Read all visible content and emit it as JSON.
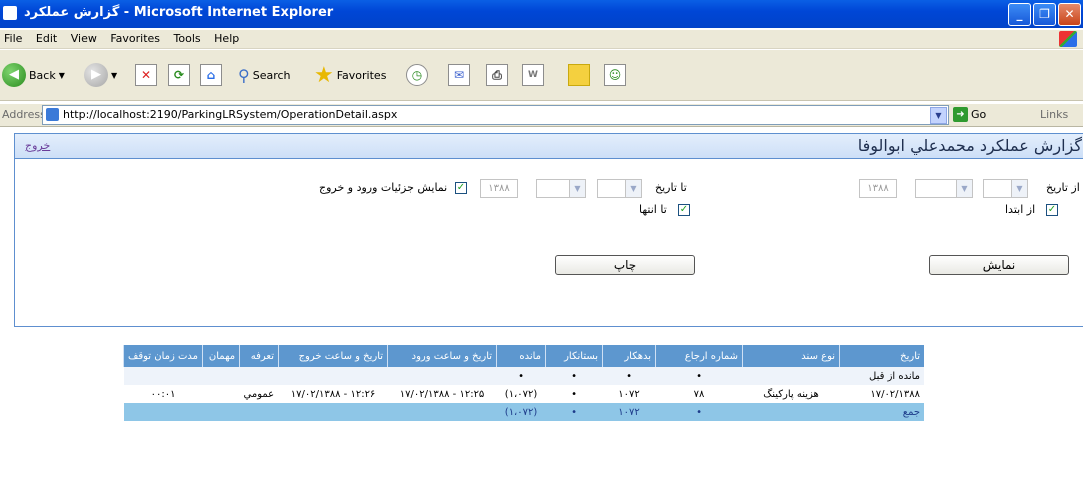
{
  "window": {
    "title": "گزارش عملكرد - Microsoft Internet Explorer"
  },
  "menu": [
    "File",
    "Edit",
    "View",
    "Favorites",
    "Tools",
    "Help"
  ],
  "toolbar": {
    "back_label": "Back",
    "search_label": "Search",
    "favorites_label": "Favorites"
  },
  "address": {
    "label": "Address",
    "url": "http://localhost:2190/ParkingLRSystem/OperationDetail.aspx",
    "go_label": "Go",
    "links_label": "Links"
  },
  "page": {
    "title": "گزارش عملكرد محمدعلي ابوالوفا",
    "exit_label": "خروج",
    "from_date_label": "از تاريخ",
    "from_beginning_label": "از ابتدا",
    "to_date_label": "تا تاريخ",
    "to_end_label": "تا انتها",
    "from_year": "۱۳۸۸",
    "to_year": "۱۳۸۸",
    "show_details_label": "نمايش جزئيات ورود و خروج",
    "show_button": "نمايش",
    "print_button": "چاپ"
  },
  "table": {
    "headers": [
      "تاريخ",
      "نوع سند",
      "شماره ارجاع",
      "بدهكار",
      "بستانكار",
      "مانده",
      "تاريخ و ساعت ورود",
      "تاريخ و ساعت خروج",
      "تعرفه",
      "مهمان",
      "مدت زمان توقف"
    ],
    "rows": [
      [
        "مانده از قبل",
        "",
        "•",
        "•",
        "•",
        "•",
        "",
        "",
        "",
        "",
        ""
      ],
      [
        "۱۷/۰۲/۱۳۸۸",
        "هزينه پاركينگ",
        "۷۸",
        "۱۰۷۲",
        "•",
        "(۱،۰۷۲)",
        "۱۲:۲۵ - ۱۷/۰۲/۱۳۸۸",
        "۱۲:۲۶ - ۱۷/۰۲/۱۳۸۸",
        "عمومي",
        "",
        "۰۰:۰۱"
      ],
      [
        "جمع",
        "",
        "•",
        "۱۰۷۲",
        "•",
        "(۱،۰۷۲)",
        "",
        "",
        "",
        "",
        ""
      ]
    ]
  }
}
